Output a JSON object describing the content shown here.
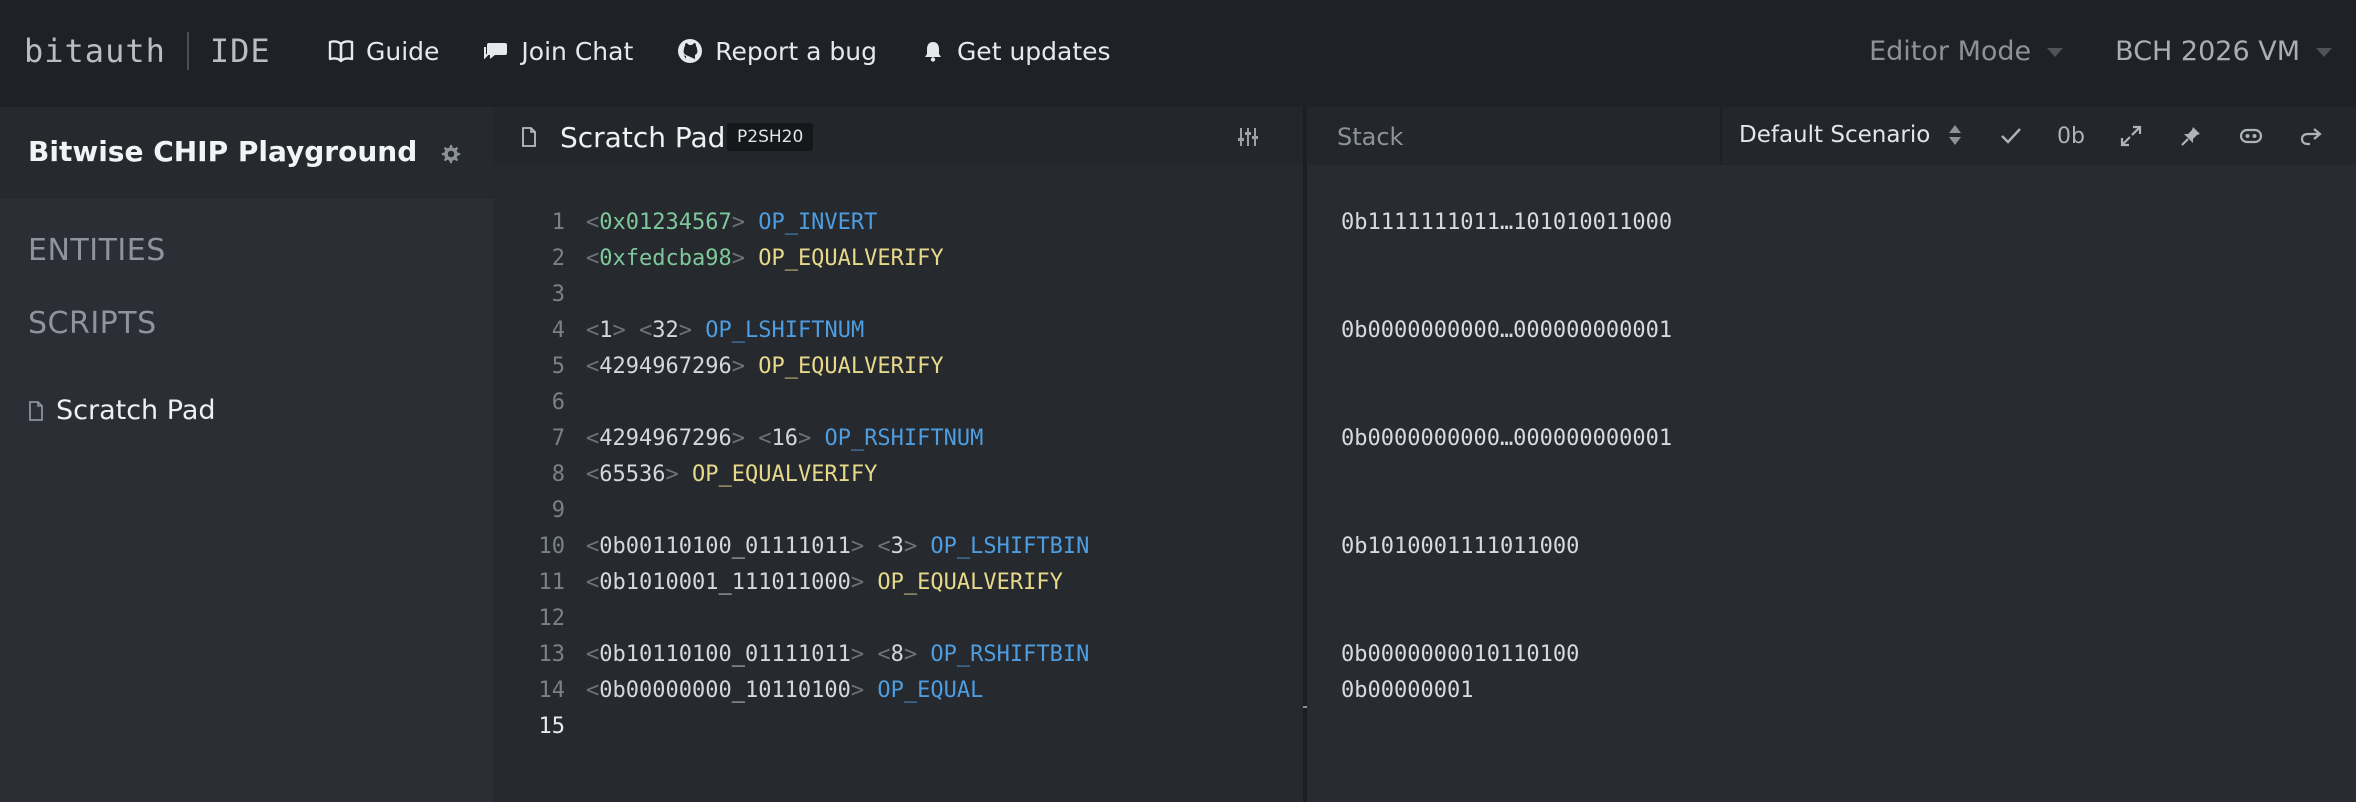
{
  "app": {
    "logo_left": "bitauth",
    "logo_right": "IDE"
  },
  "nav": {
    "links": [
      {
        "label": "Guide",
        "icon": "book-icon"
      },
      {
        "label": "Join Chat",
        "icon": "chat-icon"
      },
      {
        "label": "Report a bug",
        "icon": "github-icon"
      },
      {
        "label": "Get updates",
        "icon": "bell-icon"
      }
    ],
    "mode_label": "Editor Mode",
    "vm_label": "BCH 2026 VM"
  },
  "sidebar": {
    "title": "Bitwise CHIP Playground",
    "sections": [
      "ENTITIES",
      "SCRIPTS"
    ],
    "scripts": [
      {
        "label": "Scratch Pad"
      }
    ]
  },
  "editor": {
    "title": "Scratch Pad",
    "badge": "P2SH20",
    "active_line": 15,
    "lines": [
      [
        {
          "t": "<",
          "c": "br"
        },
        {
          "t": "0x01234567",
          "c": "hex"
        },
        {
          "t": ">",
          "c": "br"
        },
        {
          "t": " ",
          "c": "num"
        },
        {
          "t": "OP_INVERT",
          "c": "op"
        }
      ],
      [
        {
          "t": "<",
          "c": "br"
        },
        {
          "t": "0xfedcba98",
          "c": "hex"
        },
        {
          "t": ">",
          "c": "br"
        },
        {
          "t": " ",
          "c": "num"
        },
        {
          "t": "OP_EQUALVERIFY",
          "c": "verify"
        }
      ],
      [],
      [
        {
          "t": "<",
          "c": "br"
        },
        {
          "t": "1",
          "c": "num"
        },
        {
          "t": ">",
          "c": "br"
        },
        {
          "t": " ",
          "c": "num"
        },
        {
          "t": "<",
          "c": "br"
        },
        {
          "t": "32",
          "c": "num"
        },
        {
          "t": ">",
          "c": "br"
        },
        {
          "t": " ",
          "c": "num"
        },
        {
          "t": "OP_LSHIFTNUM",
          "c": "op"
        }
      ],
      [
        {
          "t": "<",
          "c": "br"
        },
        {
          "t": "4294967296",
          "c": "num"
        },
        {
          "t": ">",
          "c": "br"
        },
        {
          "t": " ",
          "c": "num"
        },
        {
          "t": "OP_EQUALVERIFY",
          "c": "verify"
        }
      ],
      [],
      [
        {
          "t": "<",
          "c": "br"
        },
        {
          "t": "4294967296",
          "c": "num"
        },
        {
          "t": ">",
          "c": "br"
        },
        {
          "t": " ",
          "c": "num"
        },
        {
          "t": "<",
          "c": "br"
        },
        {
          "t": "16",
          "c": "num"
        },
        {
          "t": ">",
          "c": "br"
        },
        {
          "t": " ",
          "c": "num"
        },
        {
          "t": "OP_RSHIFTNUM",
          "c": "op"
        }
      ],
      [
        {
          "t": "<",
          "c": "br"
        },
        {
          "t": "65536",
          "c": "num"
        },
        {
          "t": ">",
          "c": "br"
        },
        {
          "t": " ",
          "c": "num"
        },
        {
          "t": "OP_EQUALVERIFY",
          "c": "verify"
        }
      ],
      [],
      [
        {
          "t": "<",
          "c": "br"
        },
        {
          "t": "0b00110100_01111011",
          "c": "num"
        },
        {
          "t": ">",
          "c": "br"
        },
        {
          "t": " ",
          "c": "num"
        },
        {
          "t": "<",
          "c": "br"
        },
        {
          "t": "3",
          "c": "num"
        },
        {
          "t": ">",
          "c": "br"
        },
        {
          "t": " ",
          "c": "num"
        },
        {
          "t": "OP_LSHIFTBIN",
          "c": "op"
        }
      ],
      [
        {
          "t": "<",
          "c": "br"
        },
        {
          "t": "0b1010001_111011000",
          "c": "num"
        },
        {
          "t": ">",
          "c": "br"
        },
        {
          "t": " ",
          "c": "num"
        },
        {
          "t": "OP_EQUALVERIFY",
          "c": "verify"
        }
      ],
      [],
      [
        {
          "t": "<",
          "c": "br"
        },
        {
          "t": "0b10110100_01111011",
          "c": "num"
        },
        {
          "t": ">",
          "c": "br"
        },
        {
          "t": " ",
          "c": "num"
        },
        {
          "t": "<",
          "c": "br"
        },
        {
          "t": "8",
          "c": "num"
        },
        {
          "t": ">",
          "c": "br"
        },
        {
          "t": " ",
          "c": "num"
        },
        {
          "t": "OP_RSHIFTBIN",
          "c": "op"
        }
      ],
      [
        {
          "t": "<",
          "c": "br"
        },
        {
          "t": "0b00000000_10110100",
          "c": "num"
        },
        {
          "t": ">",
          "c": "br"
        },
        {
          "t": " ",
          "c": "num"
        },
        {
          "t": "OP_EQUAL",
          "c": "op"
        }
      ],
      []
    ]
  },
  "stack": {
    "label": "Stack",
    "scenario": "Default Scenario",
    "tools": [
      {
        "name": "check-icon",
        "label": ""
      },
      {
        "name": "binary-toggle",
        "label": "0b"
      },
      {
        "name": "expand-icon",
        "label": ""
      },
      {
        "name": "pin-icon",
        "label": ""
      },
      {
        "name": "link-icon",
        "label": ""
      },
      {
        "name": "redo-icon",
        "label": ""
      }
    ],
    "values": [
      {
        "line": 1,
        "text": "0b1111111011…101010011000"
      },
      {
        "line": 4,
        "text": "0b0000000000…000000000001"
      },
      {
        "line": 7,
        "text": "0b0000000000…000000000001"
      },
      {
        "line": 10,
        "text": "0b1010001111011000"
      },
      {
        "line": 13,
        "text": "0b0000000010110100"
      },
      {
        "line": 14,
        "text": "0b00000001"
      }
    ]
  },
  "colors": {
    "accent_blue": "#4d9de0",
    "accent_green": "#7ec89b",
    "accent_yellow": "#e6d98a"
  }
}
